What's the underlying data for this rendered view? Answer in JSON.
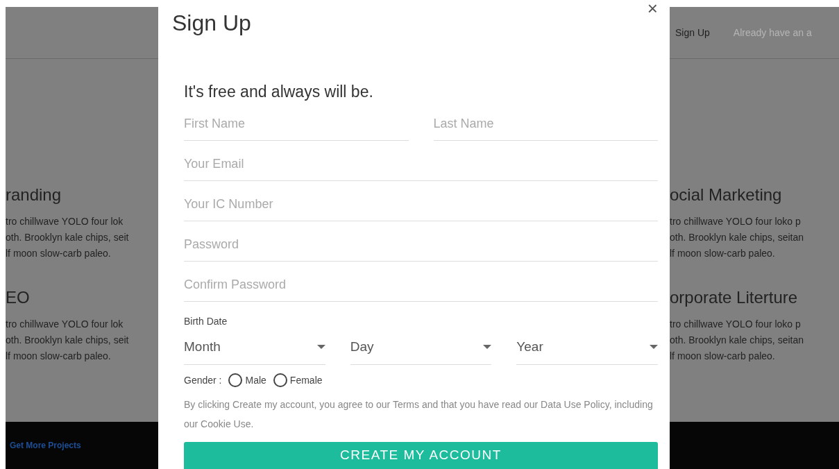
{
  "navbar": {
    "links": [
      {
        "label": "Sign Up",
        "kind": "active"
      },
      {
        "label": "Already have an a",
        "kind": "muted"
      }
    ]
  },
  "left_sections": [
    {
      "heading": "randing",
      "lines": [
        "tro chillwave YOLO four lok",
        "oth. Brooklyn kale chips, seit",
        "lf moon slow-carb paleo."
      ]
    },
    {
      "heading": "EO",
      "lines": [
        "tro chillwave YOLO four lok",
        "oth. Brooklyn kale chips, seit",
        "lf moon slow-carb paleo."
      ]
    }
  ],
  "right_sections": [
    {
      "heading": "ocial Marketing",
      "lines": [
        "tro chillwave YOLO four loko p",
        "oth. Brooklyn kale chips, seitan",
        "lf moon slow-carb paleo."
      ]
    },
    {
      "heading": "orporate Literture",
      "lines": [
        "tro chillwave YOLO four loko p",
        "oth. Brooklyn kale chips, seitan",
        "lf moon slow-carb paleo."
      ]
    }
  ],
  "footer": {
    "link": "Get More Projects"
  },
  "modal": {
    "title": "Sign Up",
    "close": "×",
    "subtitle": "It's free and always will be.",
    "field_rows": [
      [
        {
          "placeholder": "First Name"
        },
        {
          "placeholder": "Last Name"
        }
      ],
      [
        {
          "placeholder": "Your Email"
        }
      ],
      [
        {
          "placeholder": "Your IC Number"
        }
      ],
      [
        {
          "placeholder": "Password"
        }
      ],
      [
        {
          "placeholder": "Confirm Password"
        }
      ]
    ],
    "birth_date": {
      "label": "Birth Date",
      "selects": [
        {
          "value": "Month"
        },
        {
          "value": "Day"
        },
        {
          "value": "Year"
        }
      ]
    },
    "gender": {
      "label": "Gender :",
      "options": [
        {
          "label": "Male",
          "selected": false
        },
        {
          "label": "Female",
          "selected": false
        }
      ]
    },
    "terms": "By clicking Create my account, you agree to our Terms and that you have read our Data Use Policy, including our Cookie Use.",
    "submit": "CREATE MY ACCOUNT"
  }
}
